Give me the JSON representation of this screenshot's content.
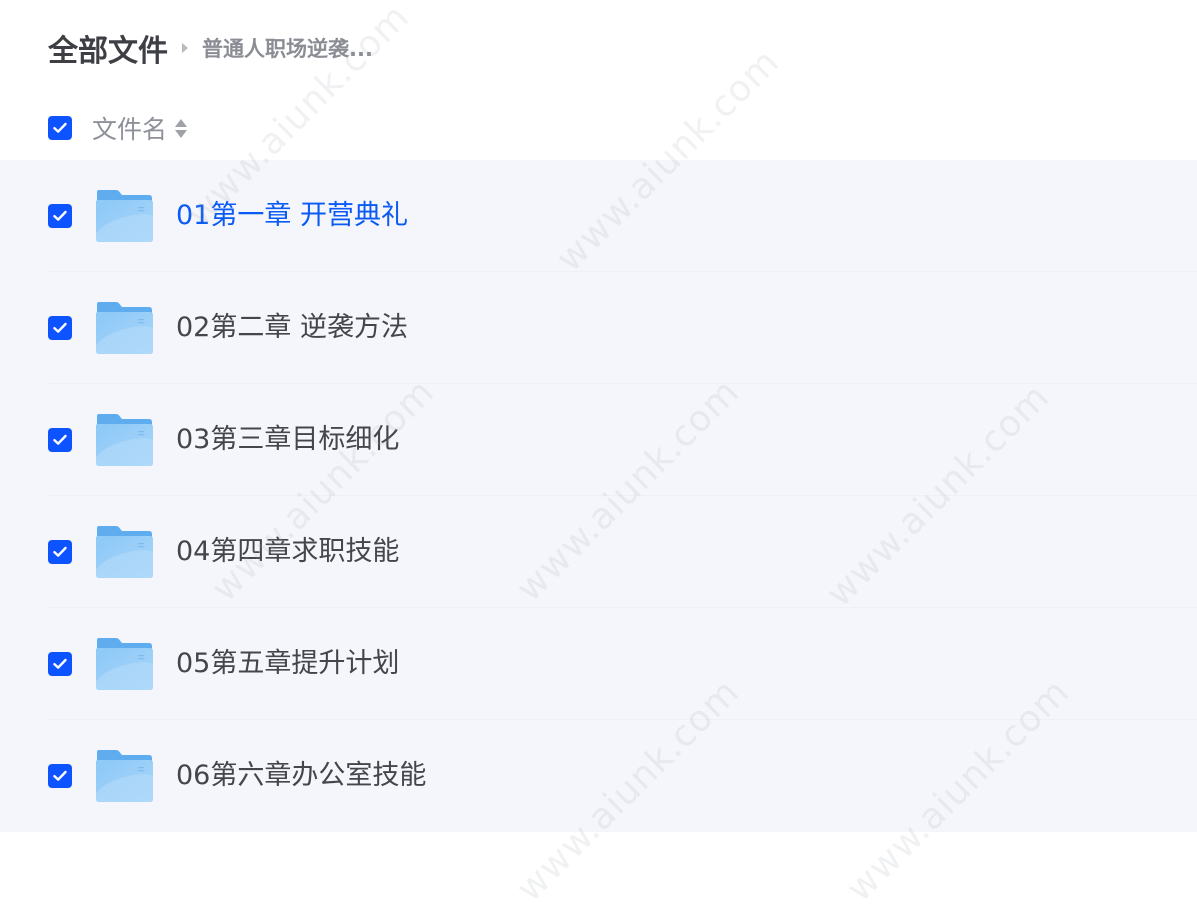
{
  "breadcrumb": {
    "root": "全部文件",
    "current": "普通人职场逆袭..."
  },
  "header": {
    "column_title": "文件名",
    "select_all_checked": true
  },
  "accent_color": "#0d53ff",
  "files": [
    {
      "name": "01第一章 开营典礼",
      "type": "folder-icon",
      "checked": true
    },
    {
      "name": "02第二章 逆袭方法",
      "type": "folder-icon",
      "checked": true
    },
    {
      "name": "03第三章目标细化",
      "type": "folder-icon",
      "checked": true
    },
    {
      "name": "04第四章求职技能",
      "type": "folder-icon",
      "checked": true
    },
    {
      "name": "05第五章提升计划",
      "type": "folder-icon",
      "checked": true
    },
    {
      "name": "06第六章办公室技能",
      "type": "folder-icon",
      "checked": true
    }
  ],
  "watermark_text": "www.aiunk.com"
}
